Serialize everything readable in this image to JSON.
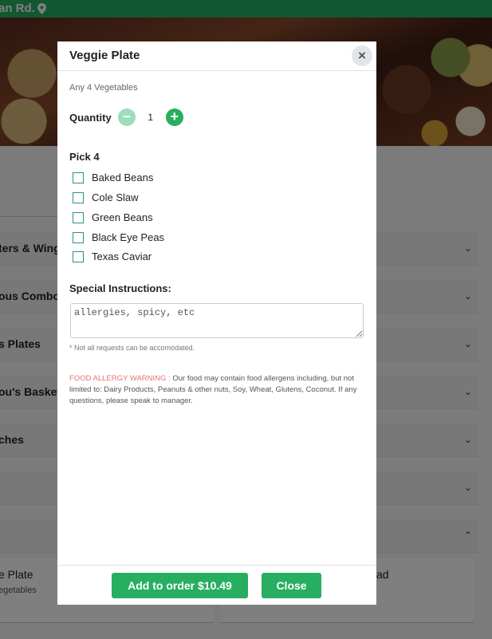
{
  "header": {
    "location": "an Rd."
  },
  "categories": [
    {
      "label": "ters & Wings"
    },
    {
      "label": "ous Combo"
    },
    {
      "label": "s Plates"
    },
    {
      "label": "ou's Baskets"
    },
    {
      "label": "ches"
    },
    {
      "label": ""
    },
    {
      "label": ""
    }
  ],
  "menu_items": [
    {
      "name": "e Plate",
      "desc": "egetables"
    },
    {
      "name": "ad",
      "desc": ""
    }
  ],
  "modal": {
    "title": "Veggie Plate",
    "close_icon": "×",
    "subtitle": "Any 4 Vegetables",
    "quantity_label": "Quantity",
    "quantity": "1",
    "pick_label": "Pick 4",
    "options": [
      "Baked Beans",
      "Cole Slaw",
      "Green Beans",
      "Black Eye Peas",
      "Texas Caviar"
    ],
    "special_label": "Special Instructions:",
    "special_placeholder": "allergies, spicy, etc",
    "note": "* Not all requests can be accomodated.",
    "warning_title": "FOOD ALLERGY WARNING :",
    "warning_text": " Our food may contain food allergens including, but not limited to: Dairy Products, Peanuts & other nuts, Soy, Wheat, Glutens, Coconut. If any questions, please speak to manager.",
    "add_button": "Add to order $10.49",
    "close_button": "Close"
  },
  "colors": {
    "brand": "#27ae60",
    "accent_light": "#9fdcb9",
    "warning": "#e57373"
  },
  "icons": {
    "location": "map-pin-icon",
    "expand": "chevron-down-icon",
    "collapse": "chevron-up-icon"
  }
}
